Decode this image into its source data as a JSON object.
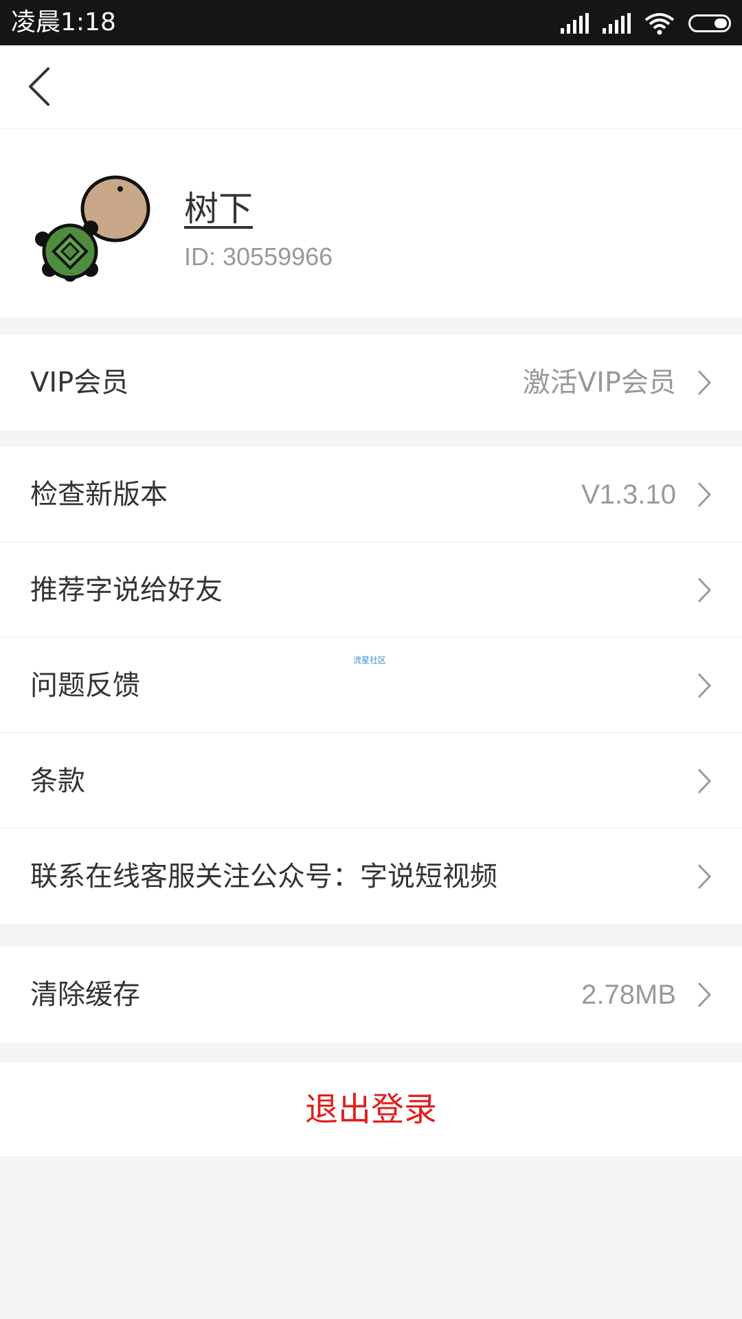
{
  "status_bar": {
    "time": "凌晨1:18"
  },
  "profile": {
    "username": "树下",
    "user_id": "ID: 30559966"
  },
  "menu": {
    "vip": {
      "label": "VIP会员",
      "value": "激活VIP会员"
    },
    "check_version": {
      "label": "检查新版本",
      "value": "V1.3.10"
    },
    "recommend": {
      "label": "推荐字说给好友"
    },
    "feedback": {
      "label": "问题反馈"
    },
    "terms": {
      "label": "条款"
    },
    "contact": {
      "label": "联系在线客服关注公众号：字说短视频"
    },
    "clear_cache": {
      "label": "清除缓存",
      "value": "2.78MB"
    }
  },
  "logout_label": "退出登录",
  "watermark": "流星社区",
  "colors": {
    "status_bar_bg": "#151515",
    "page_bg": "#f5f5f5",
    "logout_red": "#e02020",
    "secondary_text": "#999999"
  }
}
